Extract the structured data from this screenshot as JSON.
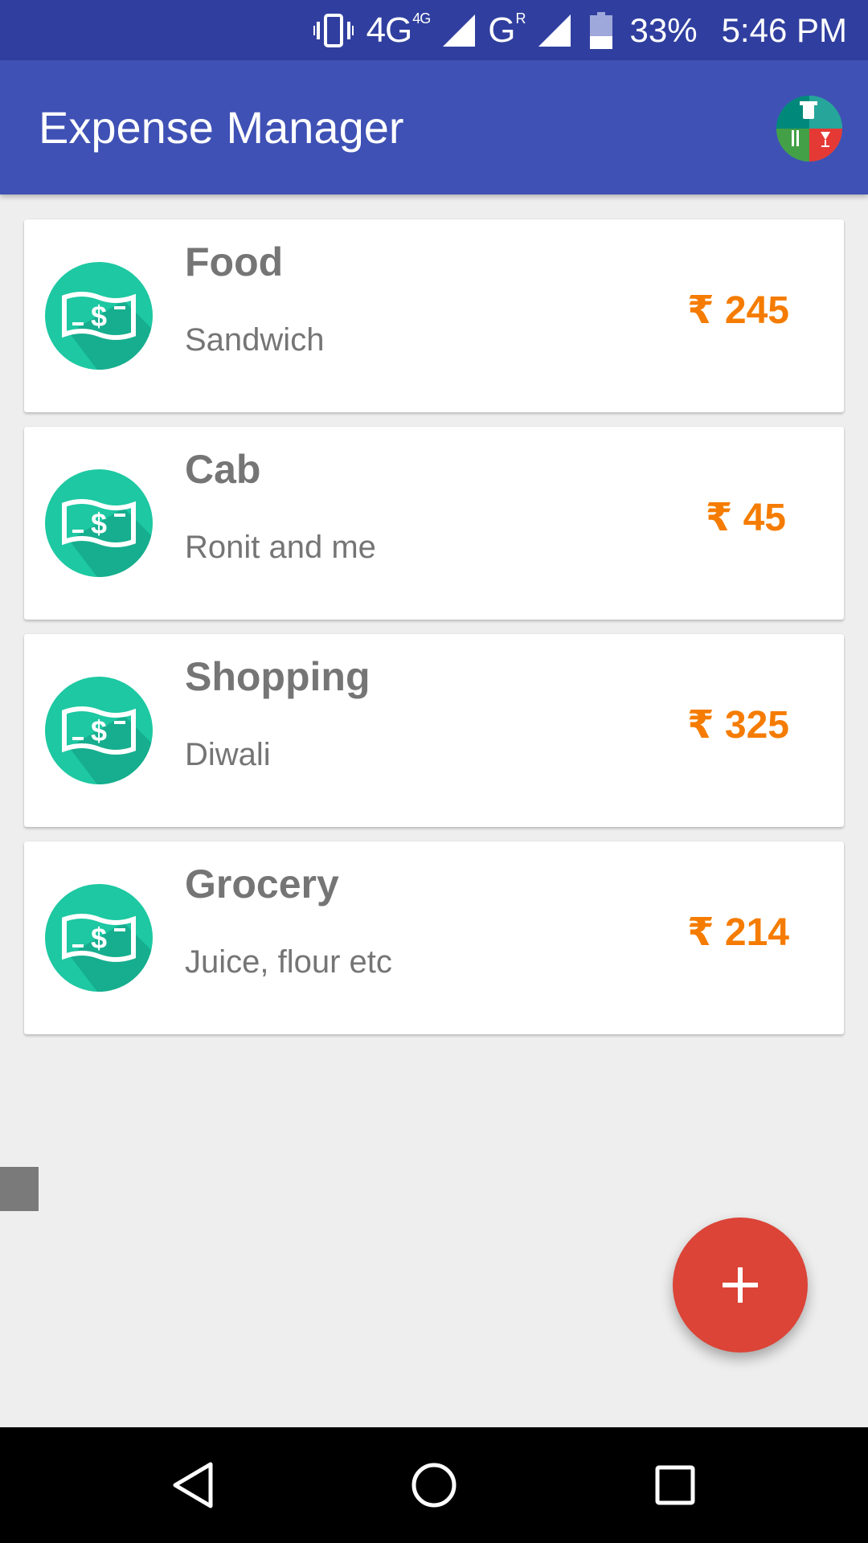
{
  "status_bar": {
    "network_1": "4G",
    "network_1_sup": "4G",
    "network_2": "G",
    "network_2_sup": "R",
    "battery": "33%",
    "time": "5:46 PM"
  },
  "app_bar": {
    "title": "Expense Manager"
  },
  "colors": {
    "primary": "#3F51B5",
    "primary_dark": "#303F9F",
    "icon_teal": "#1DC8A2",
    "amount_orange": "#F57C00",
    "fab_red": "#DB4437"
  },
  "expenses": [
    {
      "category": "Food",
      "note": "Sandwich",
      "amount": "₹ 245",
      "icon": "money-icon"
    },
    {
      "category": "Cab",
      "note": "Ronit and me",
      "amount": "₹ 45",
      "icon": "money-icon"
    },
    {
      "category": "Shopping",
      "note": "Diwali",
      "amount": "₹ 325",
      "icon": "money-icon"
    },
    {
      "category": "Grocery",
      "note": "Juice, flour etc",
      "amount": "₹ 214",
      "icon": "money-icon"
    }
  ],
  "fab": {
    "icon": "plus-icon"
  },
  "nav_bar": {
    "back": "back-icon",
    "home": "home-icon",
    "recents": "recents-icon"
  }
}
